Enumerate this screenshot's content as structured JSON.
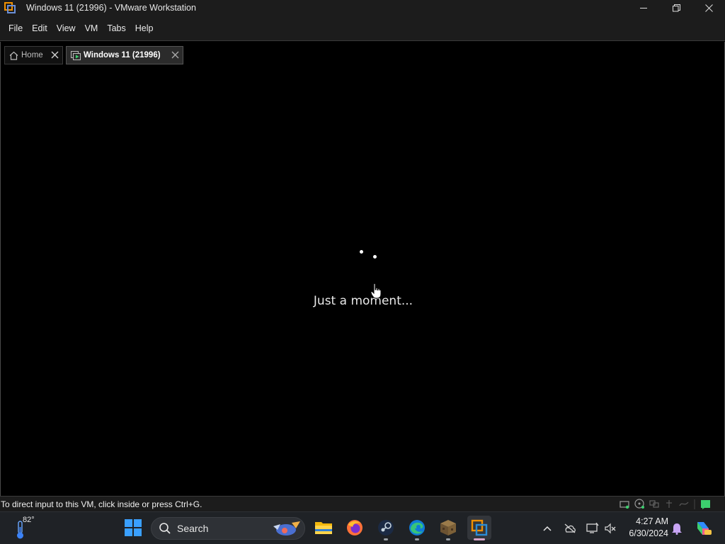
{
  "window": {
    "title": "Windows 11 (21996) - VMware Workstation"
  },
  "menu": {
    "items": [
      {
        "label": "File"
      },
      {
        "label": "Edit"
      },
      {
        "label": "View"
      },
      {
        "label": "VM"
      },
      {
        "label": "Tabs"
      },
      {
        "label": "Help"
      }
    ]
  },
  "tabs": [
    {
      "label": "Home",
      "icon": "home-icon",
      "active": false
    },
    {
      "label": "Windows 11 (21996)",
      "icon": "vm-icon",
      "active": true
    }
  ],
  "vm": {
    "loading_text": "Just a moment..."
  },
  "status": {
    "hint": "To direct input to this VM, click inside or press Ctrl+G."
  },
  "taskbar": {
    "weather_temp": "82°",
    "search_label": "Search",
    "apps": [
      "start-icon",
      "file-explorer-icon",
      "firefox-icon",
      "steam-icon",
      "edge-icon",
      "minecraft-icon",
      "vmware-icon"
    ],
    "clock_time": "4:27 AM",
    "clock_date": "6/30/2024"
  },
  "colors": {
    "accent_blue": "#0a84ff",
    "vmware_orange": "#f29100",
    "status_green": "#3ccf6e"
  }
}
